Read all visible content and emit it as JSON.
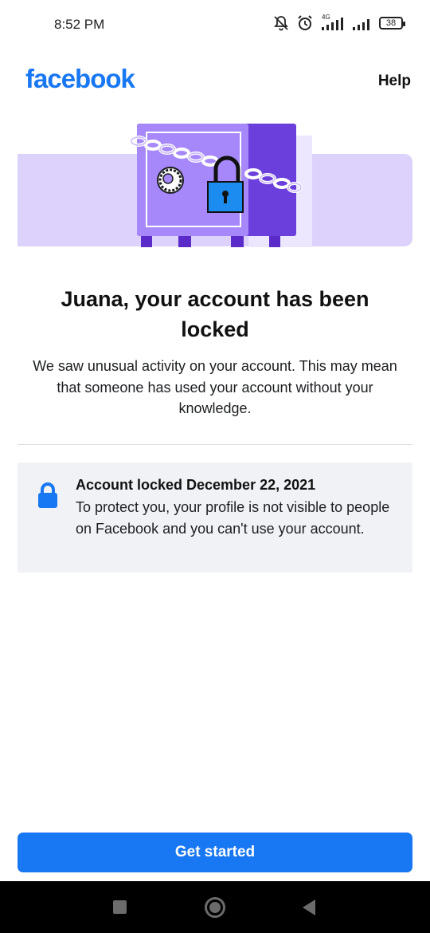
{
  "status_bar": {
    "time": "8:52 PM",
    "network_label": "4G",
    "battery_level": "38",
    "icons": [
      "muted-bell-icon",
      "alarm-clock-icon",
      "signal-4g-icon",
      "signal-icon",
      "battery-icon"
    ]
  },
  "header": {
    "logo": "facebook",
    "help_label": "Help"
  },
  "illustration": {
    "icon": "locked-safe-illustration",
    "colors": {
      "band": "#dcd2fb",
      "safe_front": "#a688fa",
      "safe_side": "#6b3fdc",
      "padlock": "#1d8cf0"
    }
  },
  "main": {
    "title": "Juana, your account has been locked",
    "subtitle": "We saw unusual activity on your account. This may mean that someone has used your account without your knowledge."
  },
  "info_card": {
    "icon": "lock-icon",
    "title": "Account locked December 22, 2021",
    "body": "To protect you, your profile is not visible to people on Facebook and you can't use your account."
  },
  "cta": {
    "label": "Get started"
  },
  "nav_bar": {
    "icons": [
      "recent-apps-icon",
      "home-icon",
      "back-icon"
    ]
  },
  "colors": {
    "brand": "#1877f2",
    "card_bg": "#f0f2f5",
    "divider": "#dadde1"
  }
}
